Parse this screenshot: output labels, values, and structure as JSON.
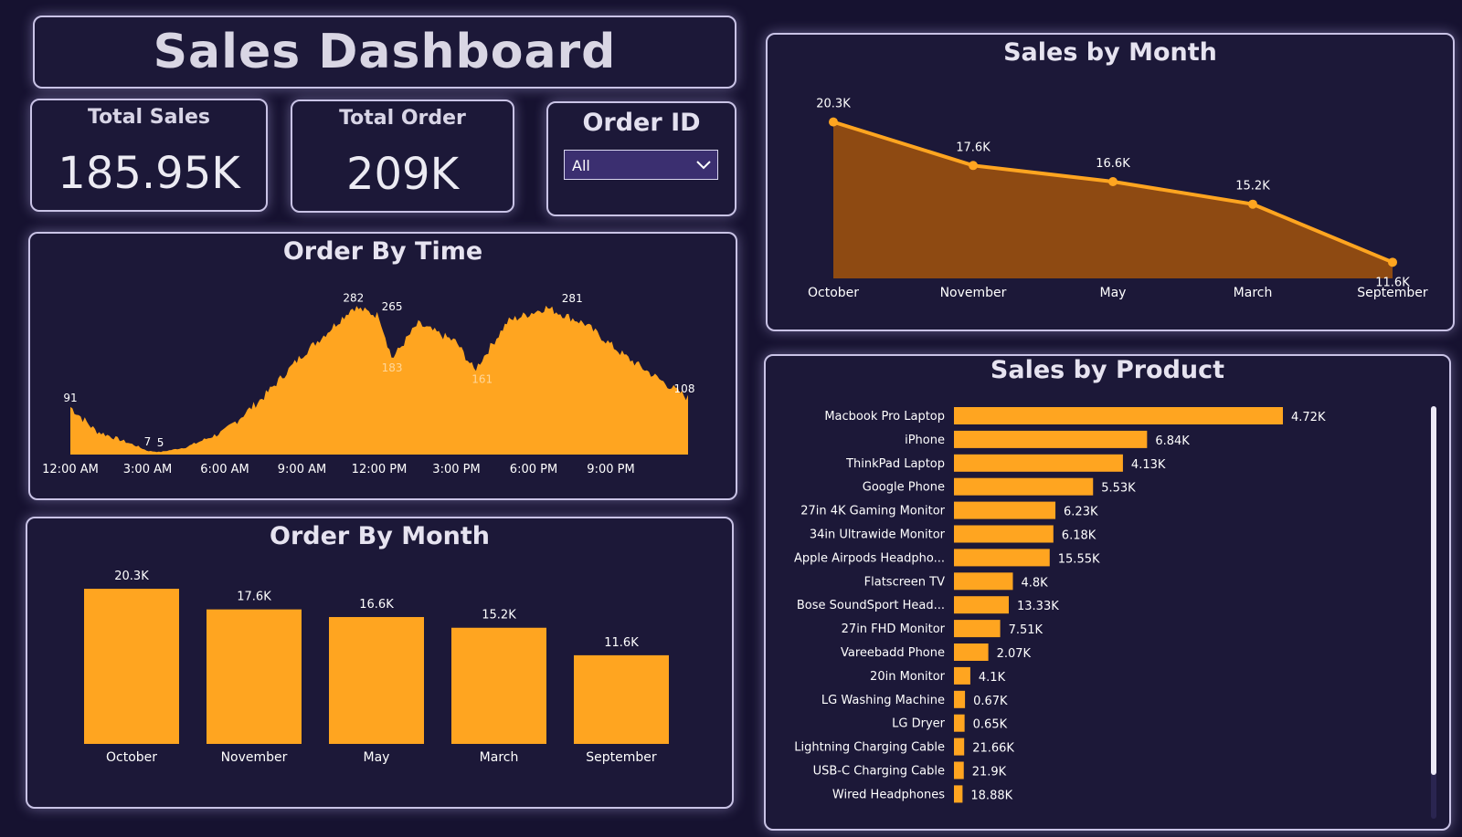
{
  "title": "Sales Dashboard",
  "kpis": {
    "total_sales": {
      "label": "Total Sales",
      "value": "185.95K"
    },
    "total_order": {
      "label": "Total Order",
      "value": "209K"
    }
  },
  "filter": {
    "label": "Order ID",
    "selected": "All"
  },
  "colors": {
    "accent": "#ffa520",
    "area_fill": "#8e4a12",
    "line": "#ffa520",
    "background": "#161230",
    "card": "#1c1838"
  },
  "chart_data": [
    {
      "id": "order_by_time",
      "type": "area",
      "title": "Order By Time",
      "x_tick_labels": [
        "12:00 AM",
        "3:00 AM",
        "6:00 AM",
        "9:00 AM",
        "12:00 PM",
        "3:00 PM",
        "6:00 PM",
        "9:00 PM"
      ],
      "x_range_hours": [
        0,
        24
      ],
      "y_range": [
        0,
        300
      ],
      "anchor_points": [
        {
          "hour": 0.0,
          "orders": 91
        },
        {
          "hour": 1.0,
          "orders": 45
        },
        {
          "hour": 2.5,
          "orders": 18
        },
        {
          "hour": 3.0,
          "orders": 7
        },
        {
          "hour": 3.5,
          "orders": 5
        },
        {
          "hour": 4.5,
          "orders": 14
        },
        {
          "hour": 6.0,
          "orders": 45
        },
        {
          "hour": 7.5,
          "orders": 110
        },
        {
          "hour": 9.0,
          "orders": 190
        },
        {
          "hour": 10.0,
          "orders": 235
        },
        {
          "hour": 11.0,
          "orders": 282
        },
        {
          "hour": 12.0,
          "orders": 265
        },
        {
          "hour": 12.5,
          "orders": 183
        },
        {
          "hour": 13.5,
          "orders": 250
        },
        {
          "hour": 15.0,
          "orders": 215
        },
        {
          "hour": 15.7,
          "orders": 161
        },
        {
          "hour": 17.0,
          "orders": 255
        },
        {
          "hour": 18.5,
          "orders": 281
        },
        {
          "hour": 20.0,
          "orders": 250
        },
        {
          "hour": 21.5,
          "orders": 190
        },
        {
          "hour": 23.0,
          "orders": 140
        },
        {
          "hour": 24.0,
          "orders": 108
        }
      ],
      "data_labels": [
        {
          "hour": 0.0,
          "orders": 91,
          "text": "91"
        },
        {
          "hour": 3.0,
          "orders": 7,
          "text": "7"
        },
        {
          "hour": 3.5,
          "orders": 5,
          "text": "5"
        },
        {
          "hour": 11.0,
          "orders": 282,
          "text": "282"
        },
        {
          "hour": 12.5,
          "orders": 265,
          "text": "265"
        },
        {
          "hour": 12.5,
          "orders": 183,
          "text": "183"
        },
        {
          "hour": 16.0,
          "orders": 161,
          "text": "161"
        },
        {
          "hour": 19.5,
          "orders": 281,
          "text": "281"
        },
        {
          "hour": 24.0,
          "orders": 108,
          "text": "108"
        }
      ]
    },
    {
      "id": "order_by_month",
      "type": "bar",
      "title": "Order By Month",
      "categories": [
        "October",
        "November",
        "May",
        "March",
        "September"
      ],
      "values": [
        20.3,
        17.6,
        16.6,
        15.2,
        11.6
      ],
      "value_labels": [
        "20.3K",
        "17.6K",
        "16.6K",
        "15.2K",
        "11.6K"
      ],
      "unit": "K",
      "ylim": [
        0,
        24
      ]
    },
    {
      "id": "sales_by_month",
      "type": "area",
      "title": "Sales by Month",
      "categories": [
        "October",
        "November",
        "May",
        "March",
        "September"
      ],
      "values": [
        20.3,
        17.6,
        16.6,
        15.2,
        11.6
      ],
      "value_labels": [
        "20.3K",
        "17.6K",
        "16.6K",
        "15.2K",
        "11.6K"
      ],
      "unit": "K",
      "ylim": [
        10.6,
        20.9
      ]
    },
    {
      "id": "sales_by_product",
      "type": "bar",
      "orientation": "horizontal",
      "title": "Sales by Product",
      "categories": [
        "Macbook Pro Laptop",
        "iPhone",
        "ThinkPad Laptop",
        "Google Phone",
        "27in 4K Gaming Monitor",
        "34in Ultrawide Monitor",
        "Apple Airpods Headpho...",
        "Flatscreen TV",
        "Bose SoundSport Head...",
        "27in FHD Monitor",
        "Vareebadd Phone",
        "20in Monitor",
        "LG Washing Machine",
        "LG Dryer",
        "Lightning Charging Cable",
        "USB-C Charging Cable",
        "Wired Headphones"
      ],
      "bar_values": [
        8.04,
        4.72,
        4.13,
        3.4,
        2.48,
        2.43,
        2.34,
        1.44,
        1.34,
        1.13,
        0.84,
        0.4,
        0.27,
        0.26,
        0.25,
        0.24,
        0.21
      ],
      "value_labels": [
        "4.72K",
        "6.84K",
        "4.13K",
        "5.53K",
        "6.23K",
        "6.18K",
        "15.55K",
        "4.8K",
        "13.33K",
        "7.51K",
        "2.07K",
        "4.1K",
        "0.67K",
        "0.65K",
        "21.66K",
        "21.9K",
        "18.88K"
      ],
      "xlim": [
        0,
        8.04
      ]
    }
  ]
}
